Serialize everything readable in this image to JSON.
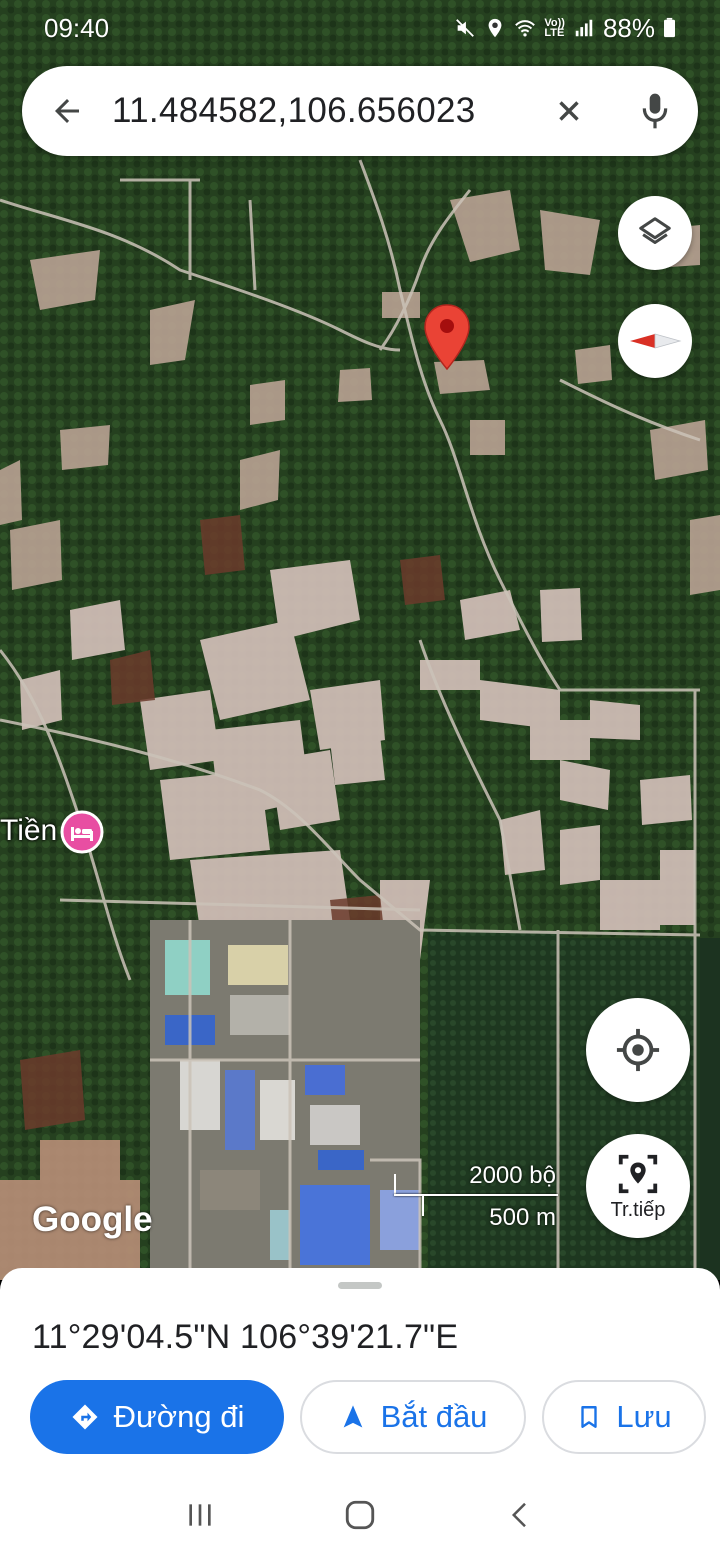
{
  "status_bar": {
    "time": "09:40",
    "battery": "88%",
    "network_label_top": "Vo))",
    "network_label_bottom": "LTE",
    "icons": [
      "mute-icon",
      "location-icon",
      "wifi-icon",
      "signal-icon",
      "battery-icon"
    ]
  },
  "search": {
    "value": "11.484582,106.656023",
    "icons": [
      "back-arrow-icon",
      "close-icon",
      "mic-icon"
    ]
  },
  "map": {
    "poi_label": "Tiền",
    "poi_icon": "hotel-icon",
    "provider": "Google",
    "scale_feet": "2000 bộ",
    "scale_meters": "500 m",
    "pin_color": "#ea4335"
  },
  "buttons": {
    "layers_icon": "layers-icon",
    "compass_icon": "compass-icon",
    "locate_icon": "my-location-icon",
    "navigate_label": "Tr.tiếp",
    "navigate_icon": "live-view-icon"
  },
  "place": {
    "coordinates": "11°29'04.5\"N 106°39'21.7\"E"
  },
  "actions": {
    "directions": "Đường đi",
    "start": "Bắt đầu",
    "save": "Lưu"
  },
  "colors": {
    "accent": "#1a73e8",
    "pin": "#ea4335",
    "hotel": "#e84ea2"
  }
}
